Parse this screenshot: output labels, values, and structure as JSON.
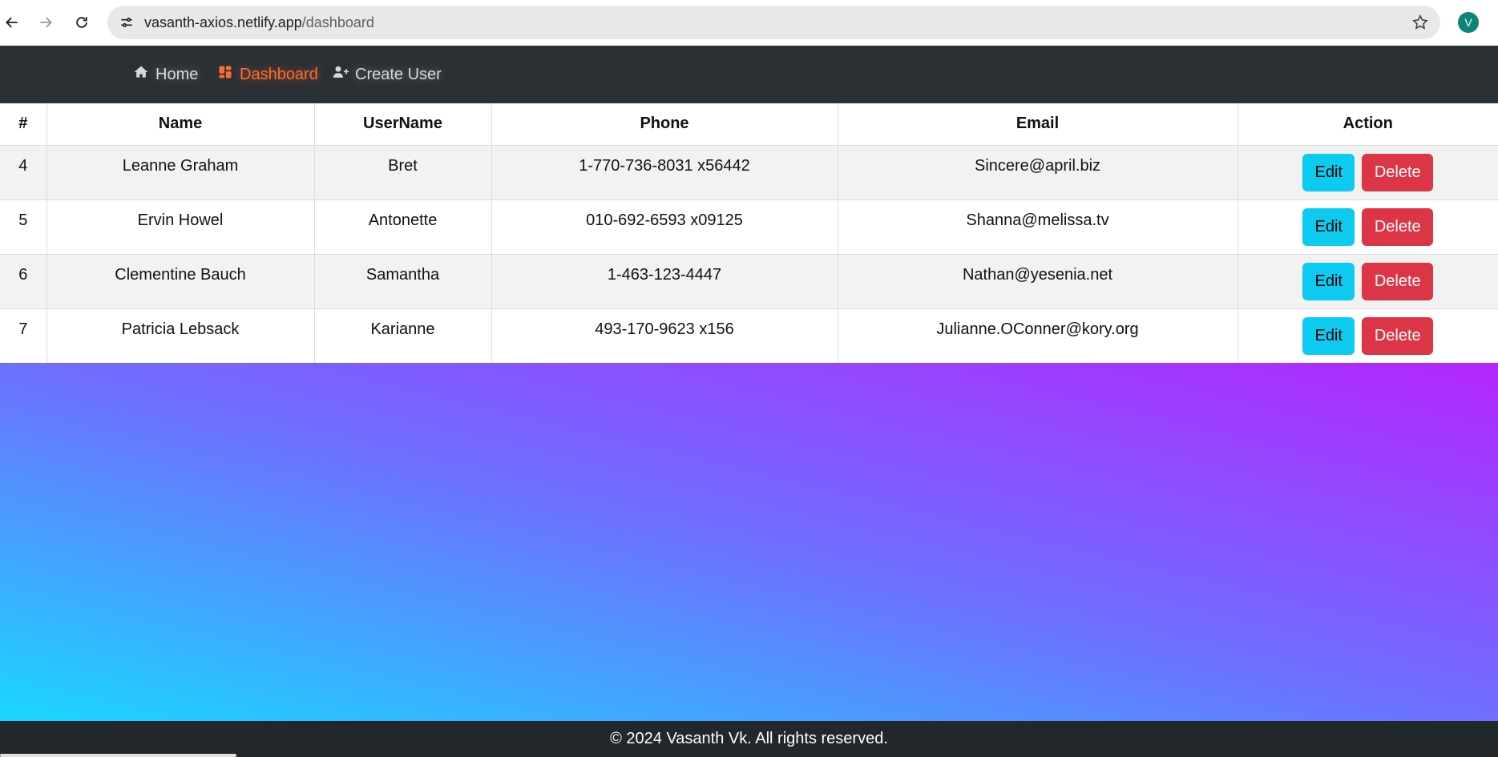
{
  "browser": {
    "url_host": "vasanth-axios.netlify.app",
    "url_path": "/dashboard",
    "avatar_letter": "V"
  },
  "nav": {
    "items": [
      {
        "label": "Home",
        "icon": "home-icon"
      },
      {
        "label": "Dashboard",
        "icon": "dashboard-icon",
        "active": true
      },
      {
        "label": "Create User",
        "icon": "user-plus-icon"
      }
    ]
  },
  "table": {
    "headers": [
      "#",
      "Name",
      "UserName",
      "Phone",
      "Email",
      "Action"
    ],
    "rows": [
      {
        "id": "4",
        "name": "Leanne Graham",
        "username": "Bret",
        "phone": "1-770-736-8031 x56442",
        "email": "Sincere@april.biz"
      },
      {
        "id": "5",
        "name": "Ervin Howel",
        "username": "Antonette",
        "phone": "010-692-6593 x09125",
        "email": "Shanna@melissa.tv"
      },
      {
        "id": "6",
        "name": "Clementine Bauch",
        "username": "Samantha",
        "phone": "1-463-123-4447",
        "email": "Nathan@yesenia.net"
      },
      {
        "id": "7",
        "name": "Patricia Lebsack",
        "username": "Karianne",
        "phone": "493-170-9623 x156",
        "email": "Julianne.OConner@kory.org"
      }
    ],
    "edit_label": "Edit",
    "delete_label": "Delete"
  },
  "footer": {
    "text": "© 2024 Vasanth Vk. All rights reserved."
  },
  "colors": {
    "navbar": "#2b3035",
    "nav_active": "#ff6b2c",
    "edit_button": "#0dcaf0",
    "delete_button": "#dc3545",
    "gradient_start": "#1ad7ff",
    "gradient_end": "#b326ff",
    "footer": "#22272c"
  }
}
